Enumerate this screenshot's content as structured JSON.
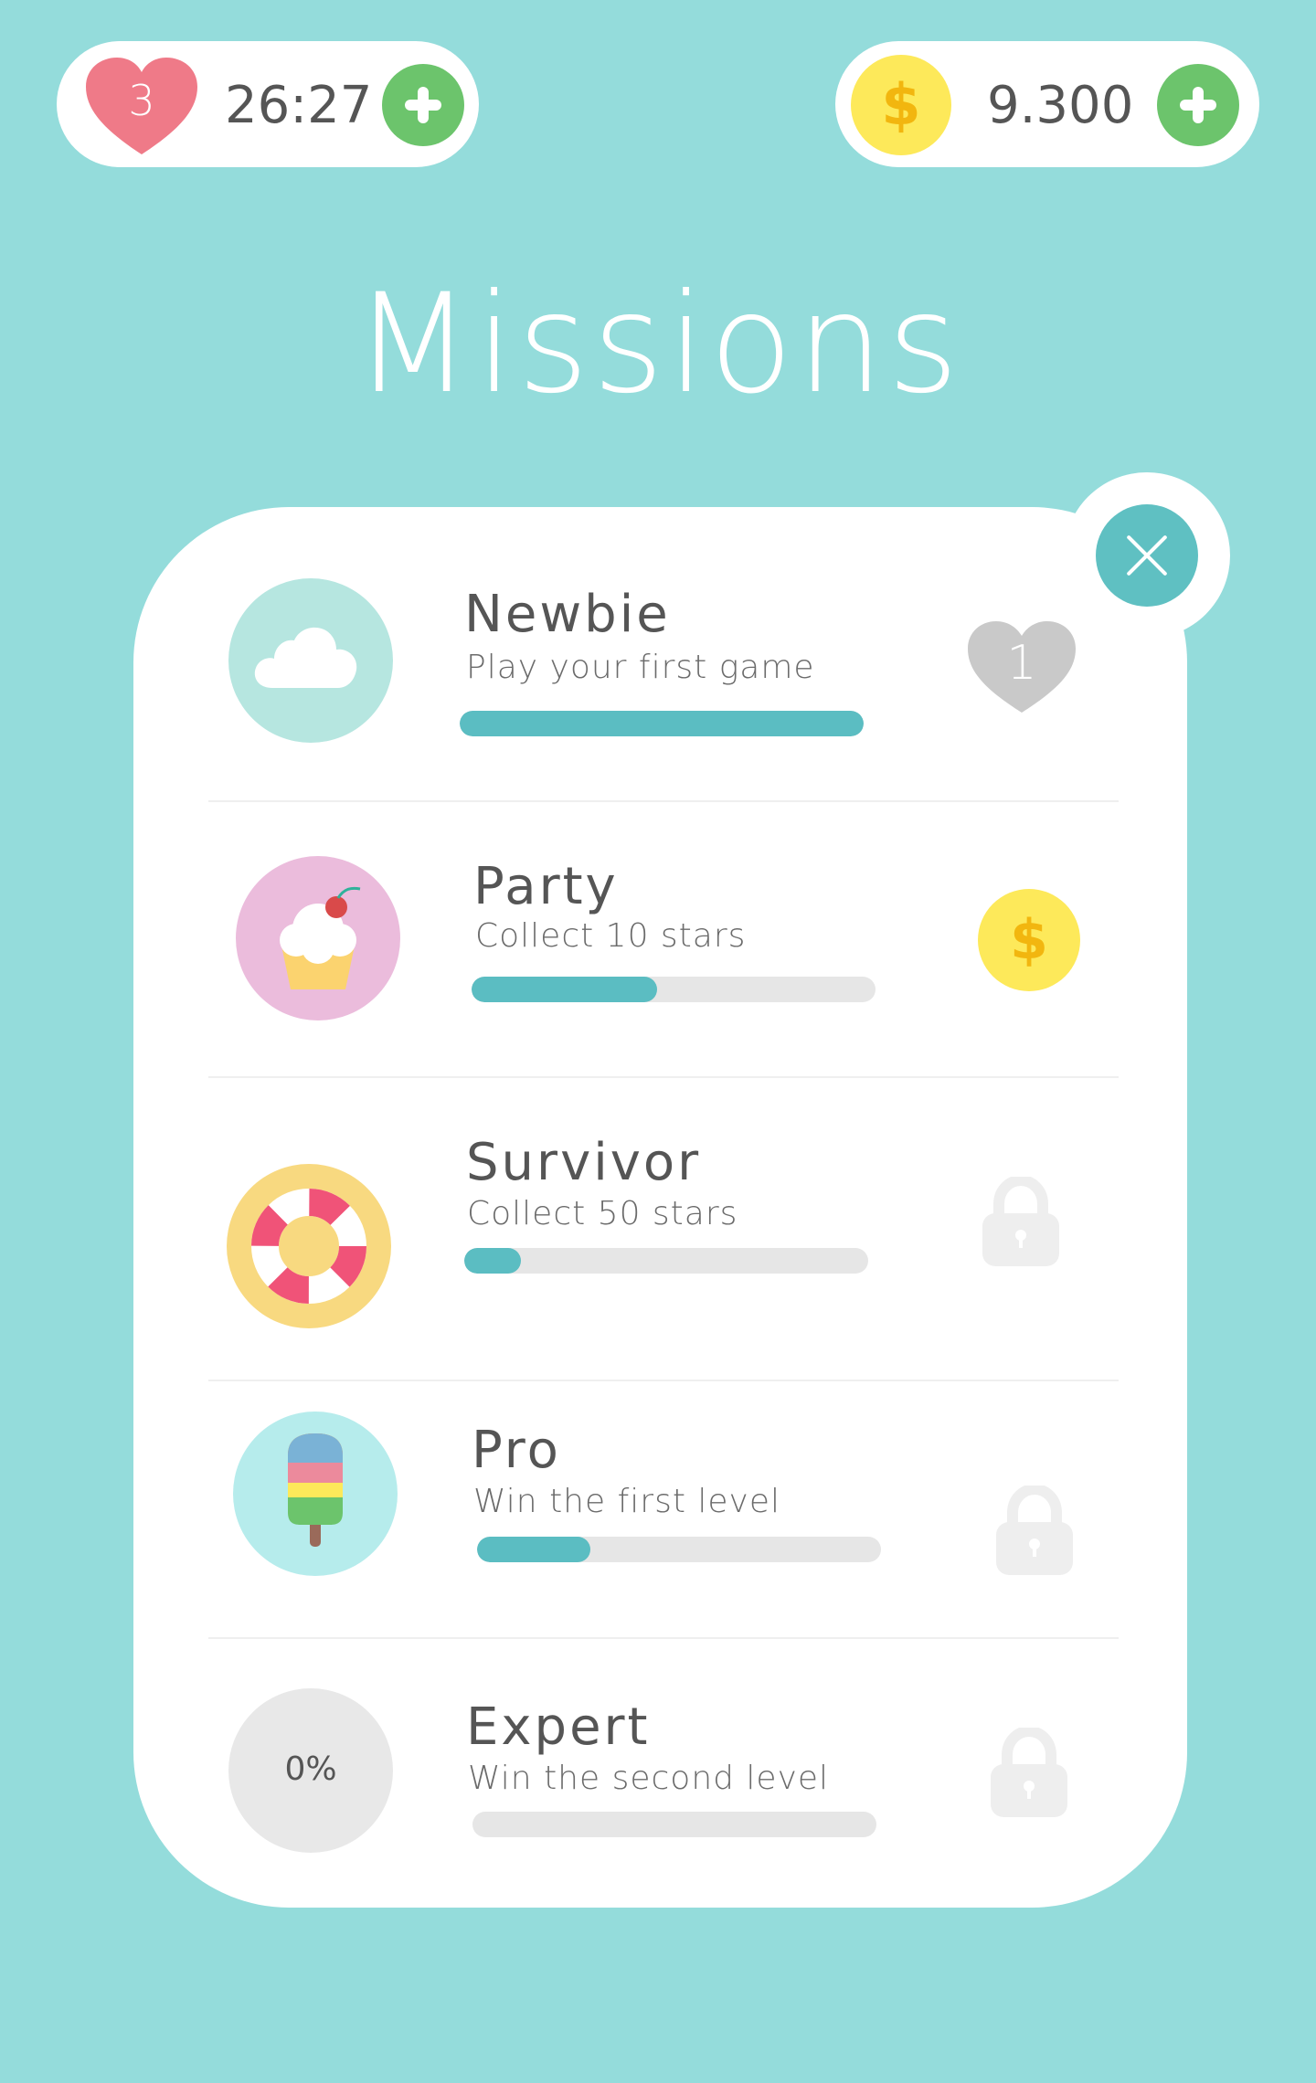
{
  "lives": {
    "count": "3",
    "timer": "26:27"
  },
  "currency": {
    "symbol": "$",
    "amount": "9.300"
  },
  "title": "Missions",
  "missions": [
    {
      "title": "Newbie",
      "subtitle": "Play your first game",
      "progress": 1.0,
      "reward": "heart",
      "reward_value": "1",
      "badge_icon": "cloud-icon",
      "badge_color": "#b6e6e0"
    },
    {
      "title": "Party",
      "subtitle": "Collect 10 stars",
      "progress": 0.46,
      "reward": "coin",
      "reward_value": "$",
      "badge_icon": "cupcake-icon",
      "badge_color": "#ebbcdc"
    },
    {
      "title": "Survivor",
      "subtitle": "Collect 50 stars",
      "progress": 0.14,
      "reward": "locked",
      "badge_icon": "lifebuoy-icon",
      "badge_color": "#f8d980"
    },
    {
      "title": "Pro",
      "subtitle": "Win the first level",
      "progress": 0.28,
      "reward": "locked",
      "badge_icon": "popsicle-icon",
      "badge_color": "#b6ecec"
    },
    {
      "title": "Expert",
      "subtitle": "Win the second level",
      "progress": 0.0,
      "reward": "locked",
      "badge_label": "0%",
      "badge_color": "#e8e8e8"
    }
  ],
  "colors": {
    "background": "#94dcdb",
    "progress": "#5bbdc2",
    "heart": "#ef7a88",
    "plus": "#6cc46c",
    "coin": "#fde95a"
  }
}
